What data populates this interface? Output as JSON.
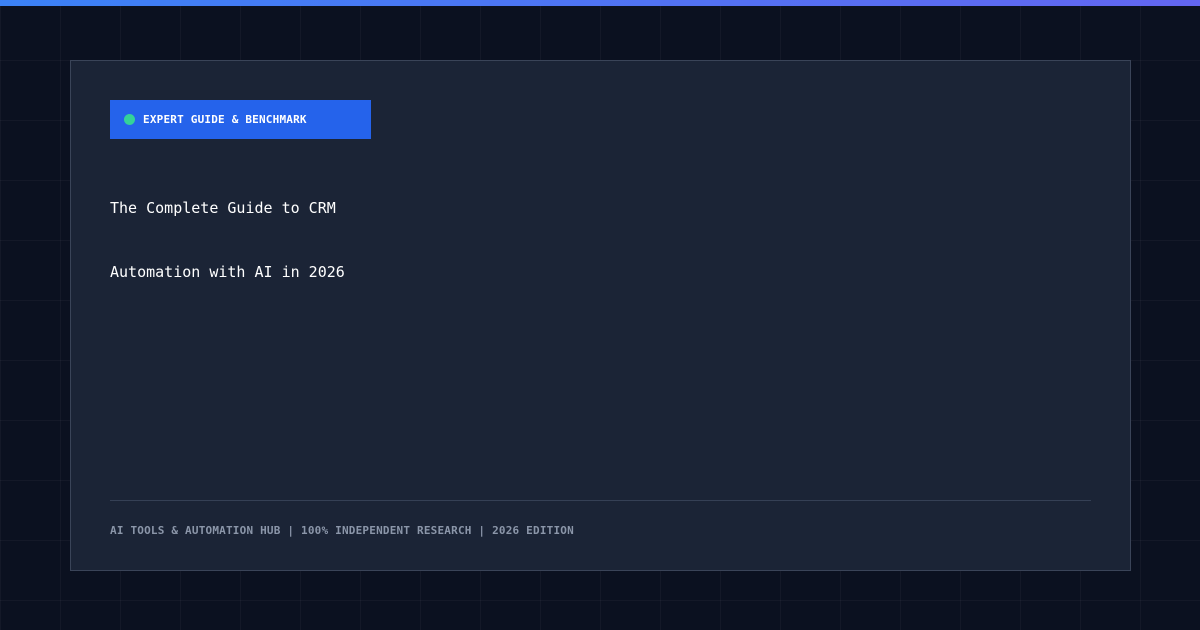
{
  "colors": {
    "background": "#0b1120",
    "card": "#1b2436",
    "accent_bar_start": "#3b82f6",
    "accent_bar_end": "#6366f1",
    "badge": "#2563eb",
    "badge_dot": "#34d399",
    "title": "#ffffff",
    "footer": "#8b96a9"
  },
  "badge": {
    "label": "EXPERT GUIDE & BENCHMARK"
  },
  "title": {
    "line1": "The Complete Guide to CRM",
    "line2": "Automation with AI in 2026"
  },
  "footer": {
    "text": "AI TOOLS & AUTOMATION HUB | 100% INDEPENDENT RESEARCH | 2026 EDITION"
  }
}
